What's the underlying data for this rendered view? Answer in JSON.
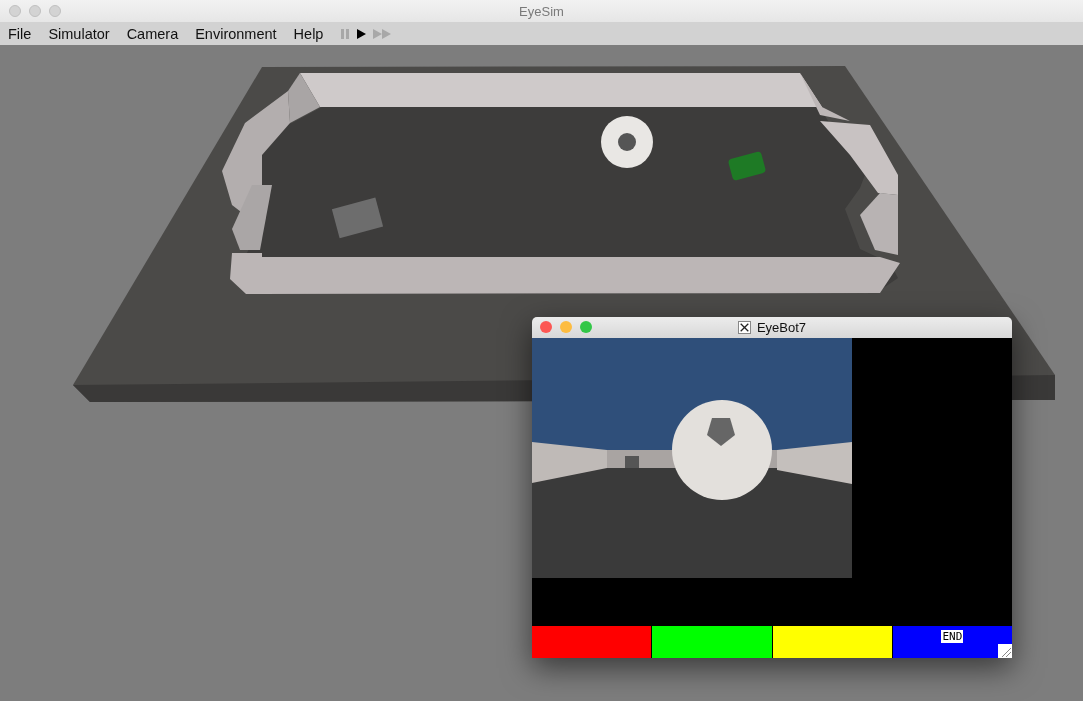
{
  "window": {
    "title": "EyeSim"
  },
  "menu": [
    "File",
    "Simulator",
    "Camera",
    "Environment",
    "Help"
  ],
  "controls": [
    {
      "kind": "pause",
      "disabled": true
    },
    {
      "kind": "play",
      "disabled": false
    },
    {
      "kind": "fast-forward",
      "disabled": true
    }
  ],
  "robot_window": {
    "title": "EyeBot7",
    "soft_keys": [
      {
        "color": "#ff0000"
      },
      {
        "color": "#00ff00"
      },
      {
        "color": "#ffff00"
      },
      {
        "color": "#0000ff",
        "label": "END"
      }
    ]
  }
}
